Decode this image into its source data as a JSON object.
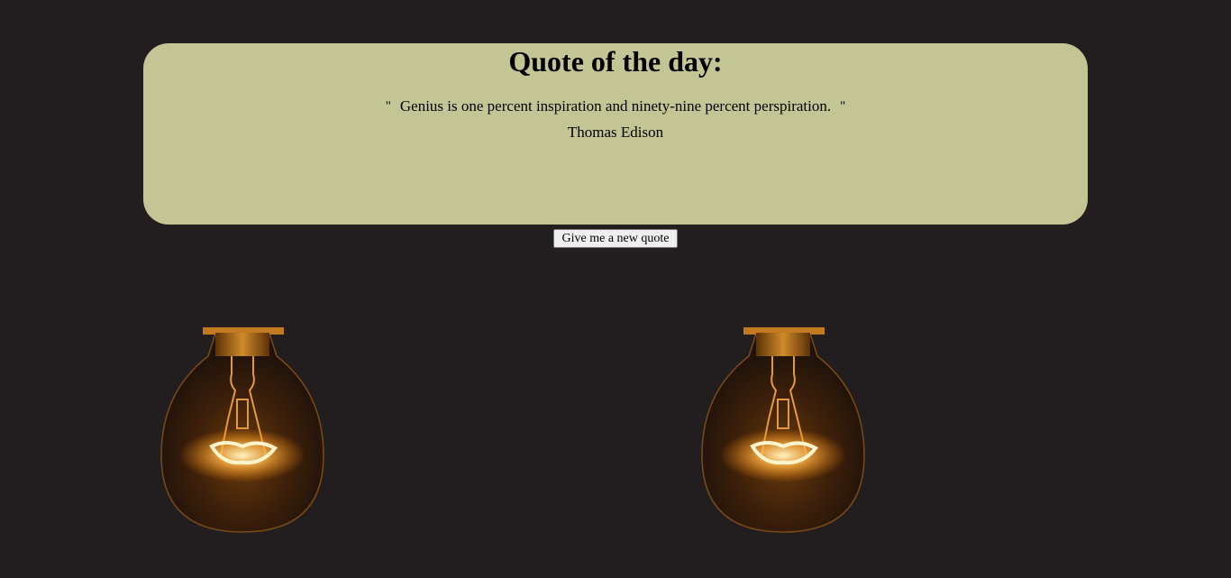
{
  "quote_card": {
    "heading": "Quote of the day:",
    "open_mark": "\"",
    "quote_text": "Genius is one percent inspiration and ninety-nine percent perspiration.",
    "close_mark": "\"",
    "author": "Thomas Edison"
  },
  "actions": {
    "new_quote_label": "Give me a new quote"
  },
  "colors": {
    "page_background": "#221e1f",
    "card_background": "#c4c595",
    "bulb_glow": "#ffb347"
  },
  "background_images": [
    "lightbulb-icon",
    "lightbulb-icon"
  ]
}
